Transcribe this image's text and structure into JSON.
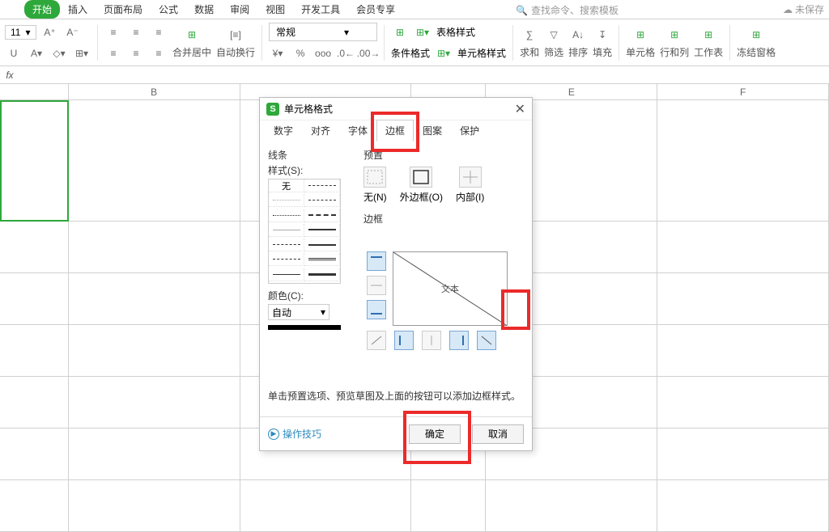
{
  "ribbon": {
    "tabs": [
      "开始",
      "插入",
      "页面布局",
      "公式",
      "数据",
      "审阅",
      "视图",
      "开发工具",
      "会员专享"
    ],
    "active_tab": "开始",
    "search_placeholder": "查找命令、搜索模板",
    "cloud_status": "未保存",
    "font_size": "11",
    "number_format": "常规",
    "merge_center": "合并居中",
    "wrap_text": "自动换行",
    "cond_fmt": "条件格式",
    "table_style": "表格样式",
    "cell_style": "单元格样式",
    "sum": "求和",
    "filter": "筛选",
    "sort": "排序",
    "fill": "填充",
    "cells": "单元格",
    "rowcol": "行和列",
    "worksheet": "工作表",
    "freeze": "冻结窗格"
  },
  "fx_label": "fx",
  "columns": [
    "B",
    "E",
    "F"
  ],
  "dialog": {
    "title": "单元格格式",
    "tabs": [
      "数字",
      "对齐",
      "字体",
      "边框",
      "图案",
      "保护"
    ],
    "active_tab": "边框",
    "line_section": "线条",
    "style_label": "样式(S):",
    "style_none": "无",
    "color_label": "颜色(C):",
    "color_value": "自动",
    "preset_section": "预置",
    "presets": {
      "none": "无(N)",
      "outer": "外边框(O)",
      "inner": "内部(I)"
    },
    "border_section": "边框",
    "preview_text": "文本",
    "hint": "单击预置选项、预览草图及上面的按钮可以添加边框样式。",
    "tips": "操作技巧",
    "ok": "确定",
    "cancel": "取消"
  }
}
